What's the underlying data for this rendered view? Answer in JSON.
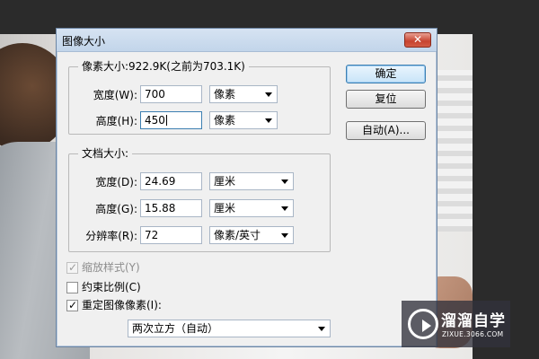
{
  "dialog": {
    "title": "图像大小",
    "close_label": "✕",
    "pixel_dimensions": {
      "legend": "像素大小:922.9K(之前为703.1K)",
      "width_label": "宽度(W):",
      "width_value": "700",
      "width_unit": "像素",
      "height_label": "高度(H):",
      "height_value": "450",
      "height_unit": "像素"
    },
    "document_size": {
      "legend": "文档大小:",
      "width_label": "宽度(D):",
      "width_value": "24.69",
      "width_unit": "厘米",
      "height_label": "高度(G):",
      "height_value": "15.88",
      "height_unit": "厘米",
      "resolution_label": "分辨率(R):",
      "resolution_value": "72",
      "resolution_unit": "像素/英寸"
    },
    "buttons": {
      "ok": "确定",
      "reset": "复位",
      "auto": "自动(A)..."
    },
    "options": {
      "scale_styles": {
        "label": "缩放样式(Y)",
        "checked": true,
        "disabled": true
      },
      "constrain_proportions": {
        "label": "约束比例(C)",
        "checked": false,
        "disabled": false
      },
      "resample_image": {
        "label": "重定图像像素(I):",
        "checked": true,
        "disabled": false
      },
      "resample_method": "两次立方（自动）"
    }
  },
  "watermark": {
    "title": "溜溜自学",
    "subtitle": "ZIXUE.3066.COM",
    "icon": "play-icon"
  },
  "colors": {
    "background": "#2b2b2b",
    "dialog_bg": "#f0f0f0",
    "titlebar": "#c2d5ea",
    "close_button": "#c7432f",
    "focus_border": "#3c7fb1"
  }
}
